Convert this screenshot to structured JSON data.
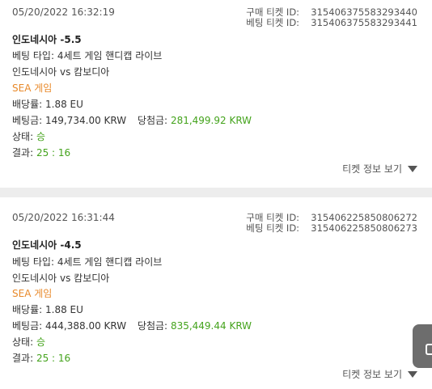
{
  "tickets": [
    {
      "date": "05/20/2022 16:32:19",
      "purchase_id_label": "구매 티켓 ID:",
      "purchase_id": "315406375583293440",
      "bet_id_label": "베팅 티켓 ID:",
      "bet_id": "315406375583293441",
      "title": "인도네시아 -5.5",
      "bet_type": "베팅 타입: 4세트 게임 핸디캡 라이브",
      "match": "인도네시아 vs 캄보디아",
      "league": "SEA 게임",
      "odds_label": "배당률:",
      "odds": "1.88 EU",
      "stake_label": "베팅금:",
      "stake": "149,734.00 KRW",
      "win_label": "당첨금:",
      "win": "281,499.92 KRW",
      "status_label": "상태:",
      "status": "승",
      "result_label": "결과:",
      "result": "25 : 16",
      "details_label": "티켓 정보 보기"
    },
    {
      "date": "05/20/2022 16:31:44",
      "purchase_id_label": "구매 티켓 ID:",
      "purchase_id": "315406225850806272",
      "bet_id_label": "베팅 티켓 ID:",
      "bet_id": "315406225850806273",
      "title": "인도네시아 -4.5",
      "bet_type": "베팅 타입: 4세트 게임 핸디캡 라이브",
      "match": "인도네시아 vs 캄보디아",
      "league": "SEA 게임",
      "odds_label": "배당률:",
      "odds": "1.88 EU",
      "stake_label": "베팅금:",
      "stake": "444,388.00 KRW",
      "win_label": "당첨금:",
      "win": "835,449.44 KRW",
      "status_label": "상태:",
      "status": "승",
      "result_label": "결과:",
      "result": "25 : 16",
      "details_label": "티켓 정보 보기"
    }
  ],
  "colors": {
    "accent_orange": "#e8892a",
    "win_green": "#44a31c",
    "divider": "#ededed"
  },
  "icons": {
    "details_arrow": "triangle-down-icon",
    "side_widget": "side-tab-icon"
  }
}
